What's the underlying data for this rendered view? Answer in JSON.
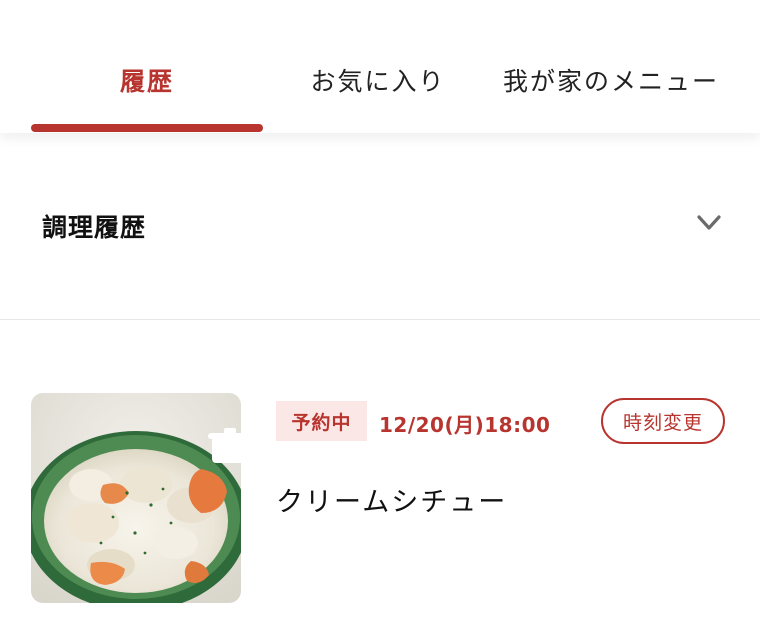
{
  "tabs": [
    {
      "label": "履歴",
      "active": true
    },
    {
      "label": "お気に入り",
      "active": false
    },
    {
      "label": "我が家のメニュー",
      "active": false
    }
  ],
  "section": {
    "title": "調理履歴",
    "chevron_icon": "chevron-down-icon"
  },
  "history_item": {
    "status_badge": "予約中",
    "scheduled_datetime": "12/20(月)18:00",
    "change_time_label": "時刻変更",
    "recipe_name": "クリームシチュー",
    "thumbnail_icon": "pot-icon"
  },
  "colors": {
    "accent": "#b8352f",
    "badge_bg": "#fbe7e6",
    "divider": "#e6e6e6"
  }
}
